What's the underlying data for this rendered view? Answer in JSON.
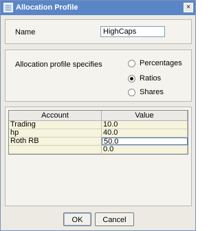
{
  "window": {
    "title": "Allocation Profile",
    "close_label": "×"
  },
  "name": {
    "label": "Name",
    "value": "HighCaps"
  },
  "allocation": {
    "label": "Allocation profile specifies",
    "options": [
      {
        "label": "Percentages",
        "selected": false
      },
      {
        "label": "Ratios",
        "selected": true
      },
      {
        "label": "Shares",
        "selected": false
      }
    ]
  },
  "table": {
    "headers": [
      "Account",
      "Value"
    ],
    "rows": [
      {
        "account": "Trading",
        "value": "10.0"
      },
      {
        "account": "hp",
        "value": "40.0"
      },
      {
        "account": "Roth RB",
        "value": "50.0"
      },
      {
        "account": "",
        "value": "0.0"
      }
    ]
  },
  "buttons": {
    "ok": "OK",
    "cancel": "Cancel"
  }
}
